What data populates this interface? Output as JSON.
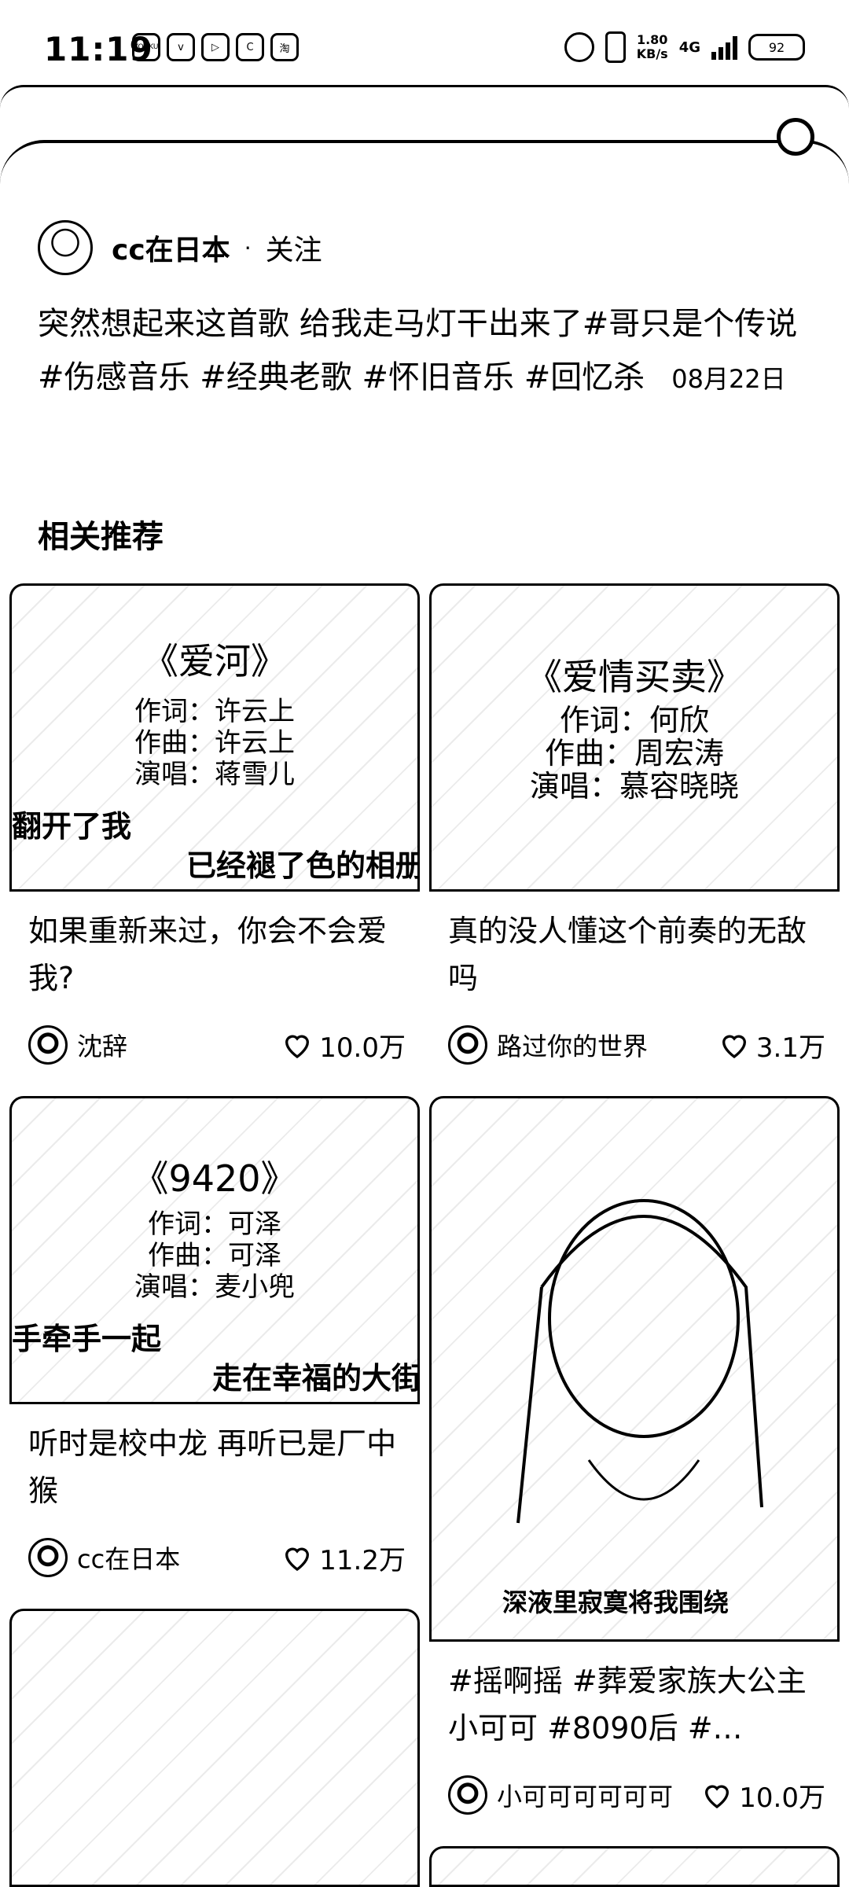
{
  "status_bar": {
    "time": "11:19",
    "app_icons": [
      "YOUKU",
      "v",
      "▷",
      "C",
      "淘"
    ],
    "net_speed": "1.80\nKB/s",
    "network": "4G",
    "battery": "92"
  },
  "post": {
    "author": "cc在日本",
    "separator": "·",
    "follow_label": "关注",
    "description": "突然想起来这首歌 给我走马灯干出来了#哥只是个传说 #伤感音乐 #经典老歌 #怀旧音乐 #回忆杀",
    "date": "08月22日"
  },
  "section_title": "相关推荐",
  "cards": [
    {
      "song": "《爱河》",
      "credits": [
        "作词：许云上",
        "作曲：许云上",
        "演唱：蒋雪儿"
      ],
      "subtitle_left": "翻开了我",
      "subtitle_right": "已经褪了色的相册",
      "title": "如果重新来过，你会不会爱我?",
      "user": "沈辞",
      "likes": "10.0万"
    },
    {
      "song": "《爱情买卖》",
      "credits": [
        "作词：何欣",
        "作曲：周宏涛",
        "演唱：慕容晓晓"
      ],
      "title": "真的没人懂这个前奏的无敌吗",
      "user": "路过你的世界",
      "likes": "3.1万"
    },
    {
      "song": "《9420》",
      "credits": [
        "作词：可泽",
        "作曲：可泽",
        "演唱：麦小兜"
      ],
      "subtitle_left": "手牵手一起",
      "subtitle_right": "走在幸福的大街",
      "title": "听时是校中龙 再听已是厂中猴",
      "user": "cc在日本",
      "likes": "11.2万"
    },
    {
      "subtitle": "深液里寂寞将我围绕",
      "title": "#摇啊摇 #葬爱家族大公主小可可 #8090后 #…",
      "user": "小可可可可可可",
      "likes": "10.0万"
    }
  ]
}
